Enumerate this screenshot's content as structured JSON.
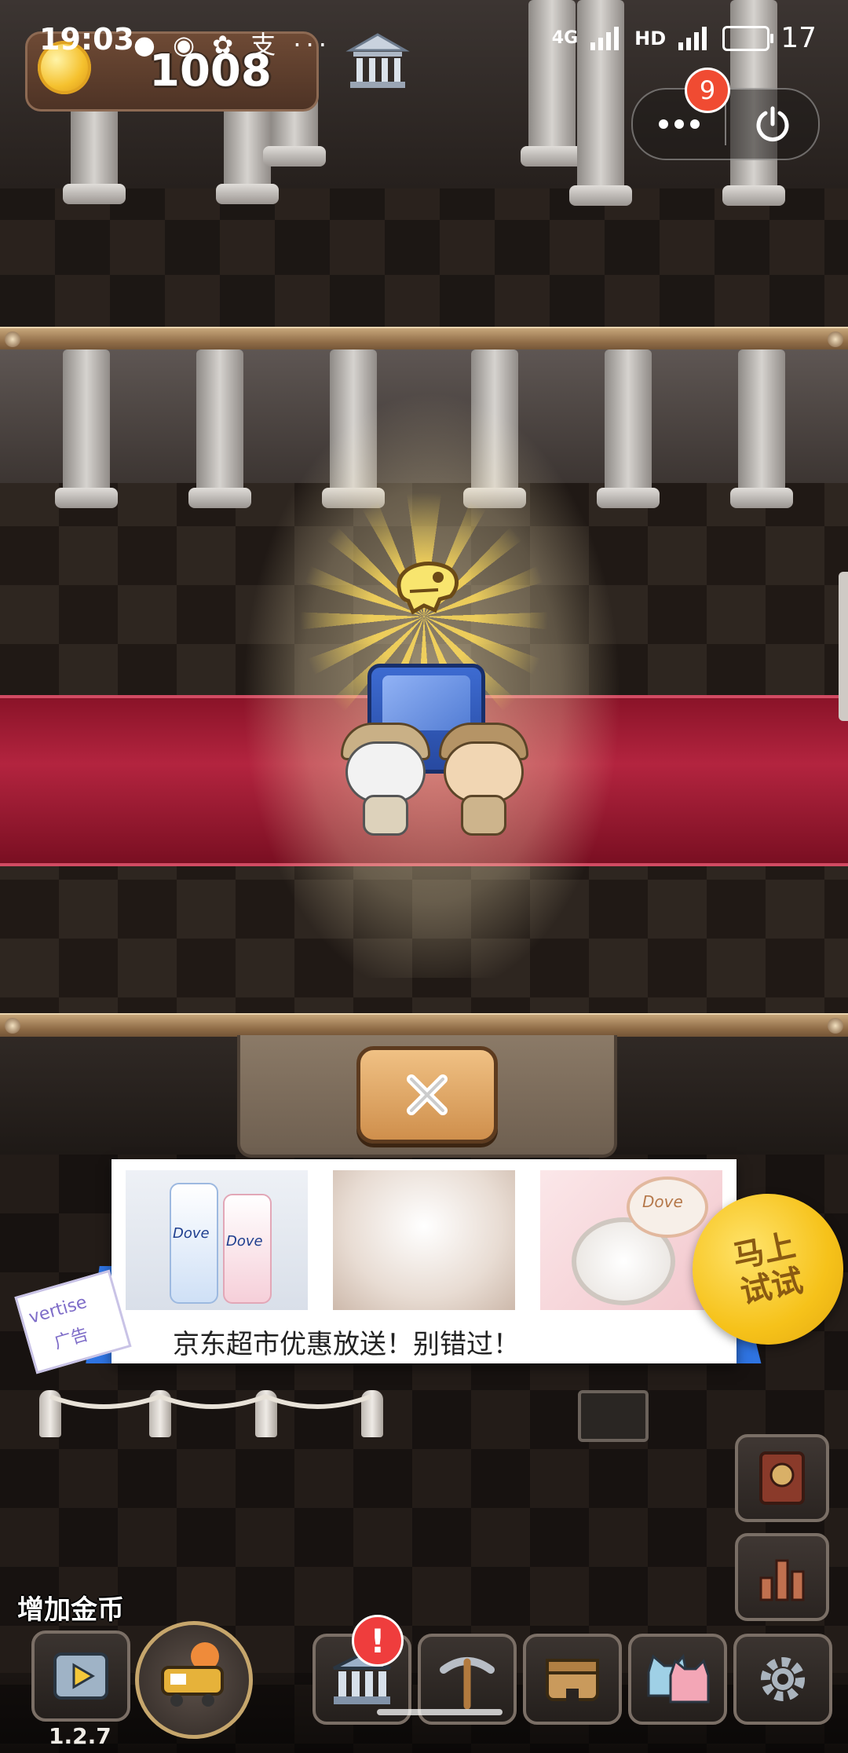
{
  "status_bar": {
    "time": "19:03",
    "left_icons": "● ◉ ✿ 支 ···",
    "network": "4G",
    "hd": "HD",
    "battery": "17"
  },
  "hud": {
    "coins": "1008"
  },
  "capsule": {
    "badge_count": "9"
  },
  "close_panel": {
    "close_glyph": "✕"
  },
  "ad": {
    "headline": "京东超市优惠放送！别错过！",
    "cta_line1": "马上",
    "cta_line2": "试试",
    "stamp_text_1": "vertise",
    "stamp_text_2": "广告",
    "product_brand": "Dove"
  },
  "left_panel": {
    "add_coins_label": "增加金币",
    "version": "1.2.7"
  },
  "toolbar": {
    "alert_glyph": "!"
  },
  "colors": {
    "accent_gold": "#f6c21a",
    "carpet_red": "#b3243f",
    "ad_blue": "#2f74e2",
    "badge_red": "#f04b32"
  }
}
